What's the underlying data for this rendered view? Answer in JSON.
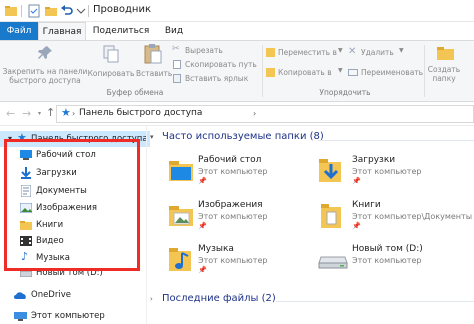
{
  "window": {
    "title": "Проводник"
  },
  "ribbon_tabs": [
    "Файл",
    "Главная",
    "Поделиться",
    "Вид"
  ],
  "ribbon": {
    "pin_label": "Закрепить на панели быстрого доступа",
    "copy_label": "Копировать",
    "paste_label": "Вставить",
    "cut_label": "Вырезать",
    "copy_path_label": "Скопировать путь",
    "paste_shortcut_label": "Вставить ярлык",
    "move_to_label": "Переместить в",
    "copy_to_label": "Копировать в",
    "delete_label": "Удалить",
    "rename_label": "Переименовать",
    "new_folder_label": "Создать папку",
    "clipboard_group": "Буфер обмена",
    "organize_group": "Упорядочить"
  },
  "address": {
    "path": "Панель быстрого доступа"
  },
  "nav_pane": {
    "quick_access": "Панель быстрого доступа",
    "items": [
      {
        "label": "Рабочий стол",
        "icon": "desktop-icon"
      },
      {
        "label": "Загрузки",
        "icon": "downloads-icon"
      },
      {
        "label": "Документы",
        "icon": "documents-icon"
      },
      {
        "label": "Изображения",
        "icon": "pictures-icon"
      },
      {
        "label": "Книги",
        "icon": "folder-icon"
      },
      {
        "label": "Видео",
        "icon": "video-icon"
      },
      {
        "label": "Музыка",
        "icon": "music-icon"
      },
      {
        "label": "Новый том (D:)",
        "icon": "drive-icon"
      },
      {
        "label": "OneDrive",
        "icon": "onedrive-icon"
      },
      {
        "label": "Этот компьютер",
        "icon": "computer-icon"
      }
    ]
  },
  "frequent": {
    "title": "Часто используемые папки (8)",
    "tiles": [
      {
        "name": "Рабочий стол",
        "location": "Этот компьютер"
      },
      {
        "name": "Загрузки",
        "location": "Этот компьютер"
      },
      {
        "name": "Изображения",
        "location": "Этот компьютер"
      },
      {
        "name": "Книги",
        "location": "Этот компьютер\\Документы"
      },
      {
        "name": "Музыка",
        "location": "Этот компьютер"
      },
      {
        "name": "Новый том (D:)",
        "location": "Этот компьютер"
      }
    ]
  },
  "recent": {
    "title": "Последние файлы (2)"
  },
  "colors": {
    "accent": "#1979ca",
    "highlight_box": "#ee2b24",
    "folder": "#f3c654",
    "section_title": "#1e3287"
  }
}
